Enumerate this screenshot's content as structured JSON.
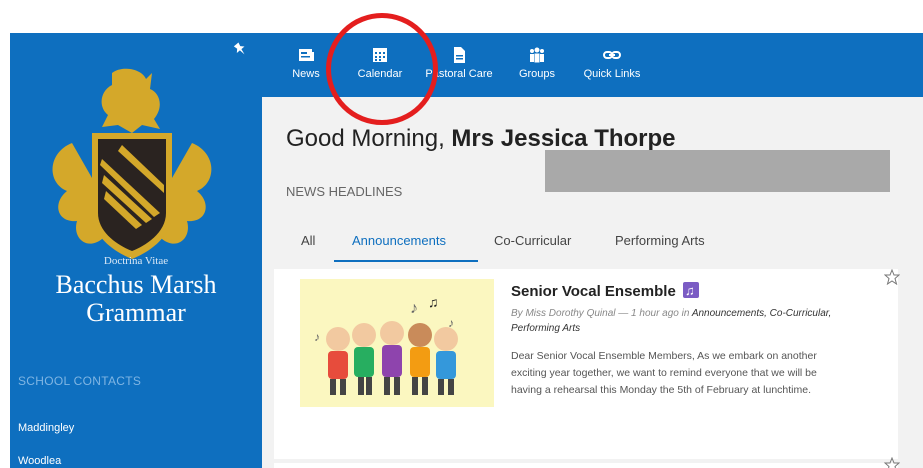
{
  "school": {
    "motto": "Doctrina Vitae",
    "name": "Bacchus Marsh Grammar",
    "colors": {
      "navy": "#0e6fbf",
      "gold": "#d4a82a",
      "dark": "#2a2320"
    }
  },
  "sidebar": {
    "contacts_heading": "SCHOOL CONTACTS",
    "contacts": [
      "Maddingley",
      "Woodlea"
    ]
  },
  "nav": {
    "items": [
      {
        "label": "News",
        "icon": "newspaper-icon"
      },
      {
        "label": "Calendar",
        "icon": "calendar-icon"
      },
      {
        "label": "Pastoral Care",
        "icon": "document-icon"
      },
      {
        "label": "Groups",
        "icon": "people-icon"
      },
      {
        "label": "Quick Links",
        "icon": "link-icon"
      }
    ]
  },
  "main": {
    "greeting_prefix": "Good Morning, ",
    "greeting_name": "Mrs Jessica Thorpe",
    "news_heading": "NEWS HEADLINES",
    "tabs": [
      {
        "label": "All",
        "active": false
      },
      {
        "label": "Announcements",
        "active": true
      },
      {
        "label": "Co-Curricular",
        "active": false
      },
      {
        "label": "Performing Arts",
        "active": false
      }
    ],
    "post": {
      "title": "Senior Vocal Ensemble",
      "title_icon": "music-note-icon",
      "meta_by": "By ",
      "author": "Miss Dorothy Quinal",
      "meta_time": " — 1 hour ago in ",
      "categories": "Announcements, Co-Curricular, Performing Arts",
      "body": "Dear Senior Vocal Ensemble Members, As we embark on another exciting year together, we want to remind everyone that we will be having a rehearsal this Monday the 5th of February at lunchtime."
    }
  },
  "annotation": {
    "highlight_color": "#e41e1e"
  }
}
